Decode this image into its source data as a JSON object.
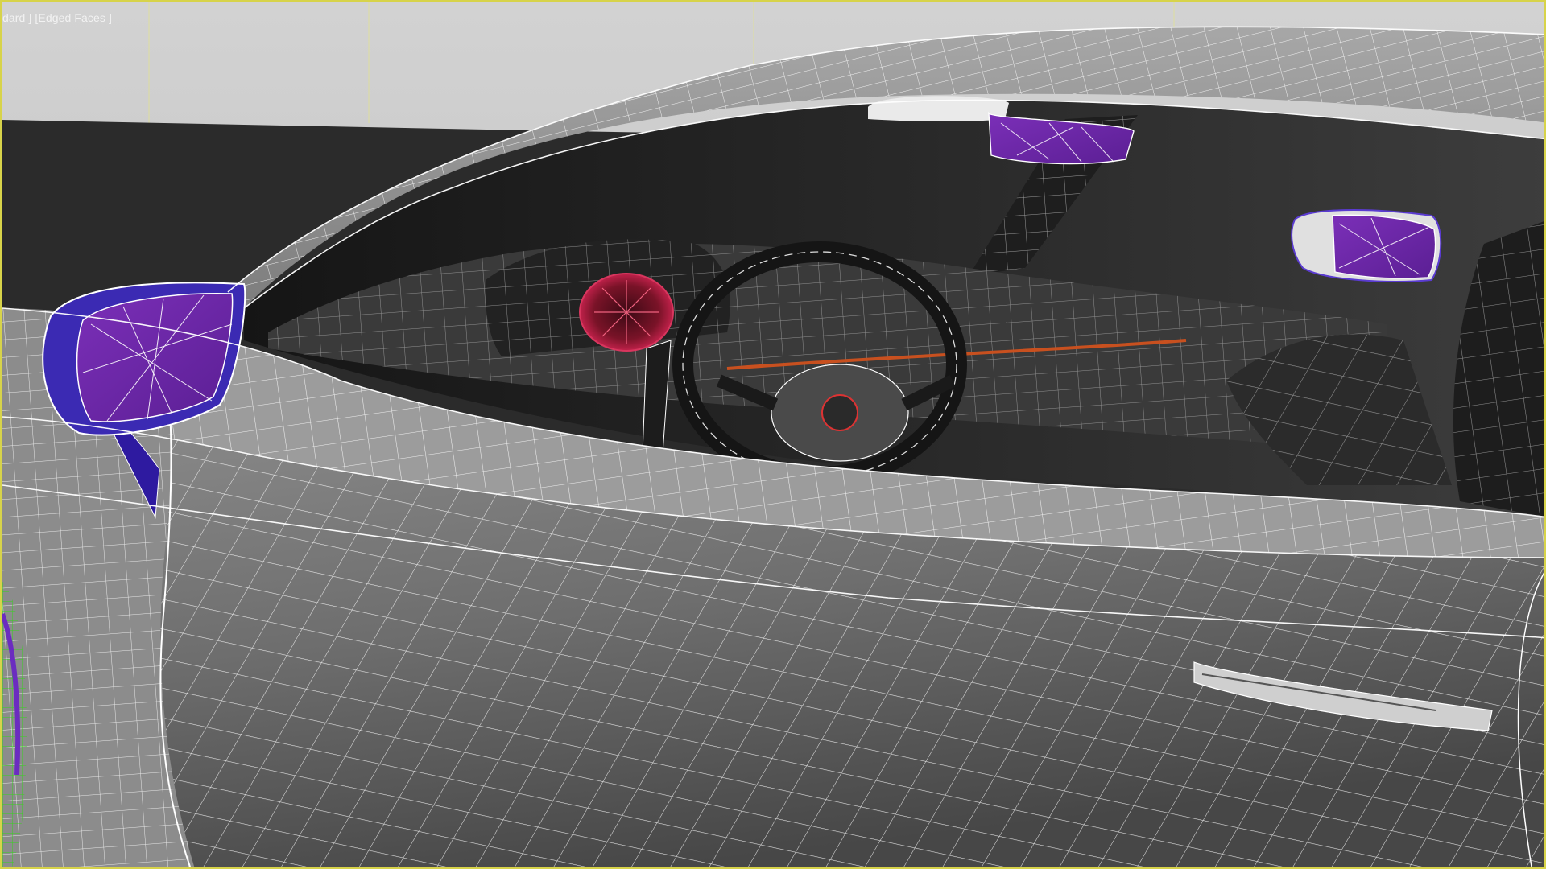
{
  "viewport": {
    "label": "dard ] [Edged Faces ]",
    "border_color": "#d7d34a",
    "background_color": "#bdbdbd",
    "shading_mode": "Edged Faces"
  },
  "scene": {
    "subject": "car body side with door, side mirror, interior dashboard and steering wheel",
    "wire_color": "#ffffff",
    "mirror_color": "#6a2aa8",
    "mirror_frame_color": "#3b2ab3",
    "selection_color": "#39d21f",
    "gauge_color": "#c0214a"
  }
}
